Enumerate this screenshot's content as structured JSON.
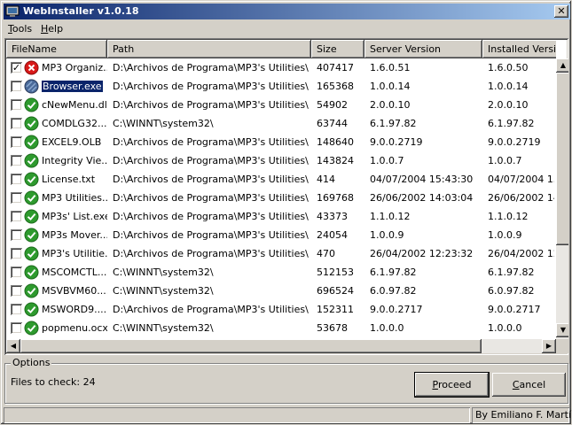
{
  "window": {
    "title": "WebInstaller v1.0.18",
    "close_label": "✕"
  },
  "menu": [
    {
      "label": "Tools"
    },
    {
      "label": "Help"
    }
  ],
  "columns": [
    {
      "label": "FileName"
    },
    {
      "label": "Path"
    },
    {
      "label": "Size"
    },
    {
      "label": "Server Version"
    },
    {
      "label": "Installed Version"
    }
  ],
  "rows": [
    {
      "checked": true,
      "status": "error-icon",
      "name": "MP3 Organiz...",
      "path": "D:\\Archivos de Programa\\MP3's Utilities\\",
      "size": "407417",
      "server": "1.6.0.51",
      "installed": "1.6.0.50"
    },
    {
      "checked": false,
      "status": "unknown-icon",
      "name": "Browser.exe",
      "path": "D:\\Archivos de Programa\\MP3's Utilities\\",
      "size": "165368",
      "server": "1.0.0.14",
      "installed": "1.0.0.14",
      "selected": true
    },
    {
      "checked": false,
      "status": "ok-icon",
      "name": "cNewMenu.dll",
      "path": "D:\\Archivos de Programa\\MP3's Utilities\\",
      "size": "54902",
      "server": "2.0.0.10",
      "installed": "2.0.0.10"
    },
    {
      "checked": false,
      "status": "ok-icon",
      "name": "COMDLG32....",
      "path": "C:\\WINNT\\system32\\",
      "size": "63744",
      "server": "6.1.97.82",
      "installed": "6.1.97.82"
    },
    {
      "checked": false,
      "status": "ok-icon",
      "name": "EXCEL9.OLB",
      "path": "D:\\Archivos de Programa\\MP3's Utilities\\",
      "size": "148640",
      "server": "9.0.0.2719",
      "installed": "9.0.0.2719"
    },
    {
      "checked": false,
      "status": "ok-icon",
      "name": "Integrity Vie...",
      "path": "D:\\Archivos de Programa\\MP3's Utilities\\",
      "size": "143824",
      "server": "1.0.0.7",
      "installed": "1.0.0.7"
    },
    {
      "checked": false,
      "status": "ok-icon",
      "name": "License.txt",
      "path": "D:\\Archivos de Programa\\MP3's Utilities\\",
      "size": "414",
      "server": "04/07/2004 15:43:30",
      "installed": "04/07/2004 15:"
    },
    {
      "checked": false,
      "status": "ok-icon",
      "name": "MP3 Utilities....",
      "path": "D:\\Archivos de Programa\\MP3's Utilities\\",
      "size": "169768",
      "server": "26/06/2002 14:03:04",
      "installed": "26/06/2002 14:"
    },
    {
      "checked": false,
      "status": "ok-icon",
      "name": "MP3s' List.exe",
      "path": "D:\\Archivos de Programa\\MP3's Utilities\\",
      "size": "43373",
      "server": "1.1.0.12",
      "installed": "1.1.0.12"
    },
    {
      "checked": false,
      "status": "ok-icon",
      "name": "MP3s Mover....",
      "path": "D:\\Archivos de Programa\\MP3's Utilities\\",
      "size": "24054",
      "server": "1.0.0.9",
      "installed": "1.0.0.9"
    },
    {
      "checked": false,
      "status": "ok-icon",
      "name": "MP3's Utilitie...",
      "path": "D:\\Archivos de Programa\\MP3's Utilities\\",
      "size": "470",
      "server": "26/04/2002 12:23:32",
      "installed": "26/04/2002 12:"
    },
    {
      "checked": false,
      "status": "ok-icon",
      "name": "MSCOMCTL....",
      "path": "C:\\WINNT\\system32\\",
      "size": "512153",
      "server": "6.1.97.82",
      "installed": "6.1.97.82"
    },
    {
      "checked": false,
      "status": "ok-icon",
      "name": "MSVBVM60....",
      "path": "C:\\WINNT\\system32\\",
      "size": "696524",
      "server": "6.0.97.82",
      "installed": "6.0.97.82"
    },
    {
      "checked": false,
      "status": "ok-icon",
      "name": "MSWORD9....",
      "path": "D:\\Archivos de Programa\\MP3's Utilities\\",
      "size": "152311",
      "server": "9.0.0.2717",
      "installed": "9.0.0.2717"
    },
    {
      "checked": false,
      "status": "ok-icon",
      "name": "popmenu.ocx",
      "path": "C:\\WINNT\\system32\\",
      "size": "53678",
      "server": "1.0.0.0",
      "installed": "1.0.0.0"
    }
  ],
  "options": {
    "legend": "Options",
    "files_to_check": "Files to check: 24",
    "proceed_label": "Proceed",
    "cancel_label": "Cancel"
  },
  "status": {
    "author": "By Emiliano F. Martín"
  },
  "colors": {
    "title_start": "#0a246a",
    "title_end": "#a6caf0",
    "ok": "#2e9a2e",
    "error": "#d81818",
    "face": "#d4d0c8"
  }
}
